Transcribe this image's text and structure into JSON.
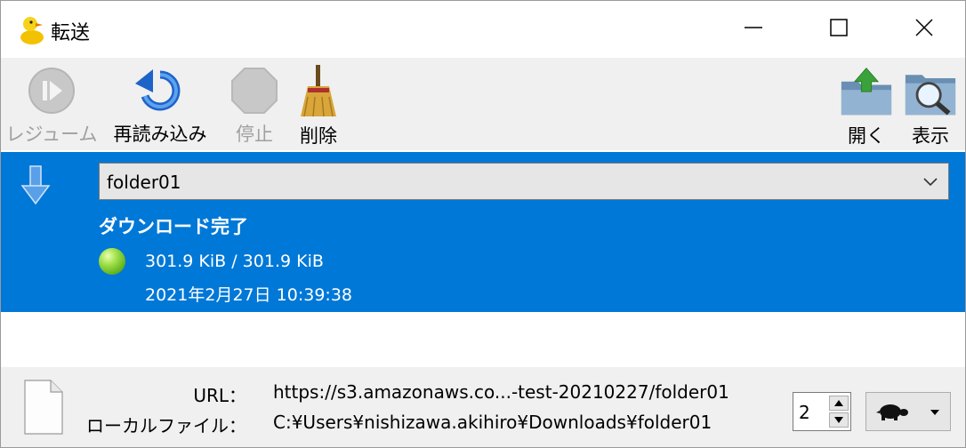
{
  "window": {
    "title": "転送",
    "app_icon": "duck-icon",
    "controls": [
      "minimize-icon",
      "maximize-icon",
      "close-icon"
    ]
  },
  "toolbar": {
    "resume_label": "レジューム",
    "reload_label": "再読み込み",
    "stop_label": "停止",
    "delete_label": "削除",
    "open_label": "開く",
    "show_label": "表示"
  },
  "transfer": {
    "direction_icon": "download-arrow-icon",
    "folder": "folder01",
    "status": "ダウンロード完了",
    "status_color": "#7ec83a",
    "size": "301.9 KiB / 301.9 KiB",
    "timestamp": "2021年2月27日 10:39:38",
    "selected_color": "#0078d7"
  },
  "info": {
    "url_label": "URL：",
    "url_value": "https://s3.amazonaws.co...-test-20210227/folder01",
    "local_label": "ローカルファイル：",
    "local_value": "C:¥Users¥nishizawa.akihiro¥Downloads¥folder01",
    "connections": "2",
    "speed_icon": "turtle-icon"
  }
}
